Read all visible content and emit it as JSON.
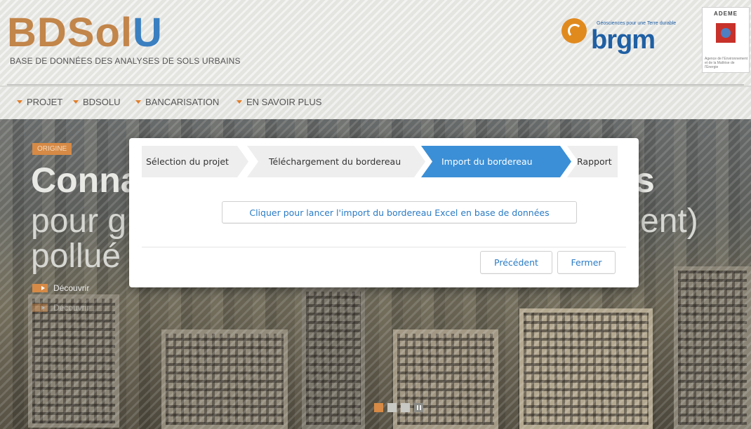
{
  "header": {
    "logo_part1": "BDSol",
    "logo_part2": "U",
    "subtitle": "BASE DE DONNÉES DES ANALYSES DE SOLS URBAINS",
    "brgm_name": "brgm",
    "brgm_tagline": "Géosciences pour une Terre durable",
    "ademe_name": "ADEME",
    "ademe_tagline": "Agence de l'Environnement et de la Maîtrise de l'Énergie"
  },
  "nav": {
    "items": [
      {
        "label": "PROJET"
      },
      {
        "label": "BDSOLU"
      },
      {
        "label": "BANCARISATION"
      },
      {
        "label": "EN SAVOIR PLUS"
      }
    ]
  },
  "hero": {
    "badge": "ORIGINE",
    "line1": "Conna",
    "line1_right": "s",
    "line2": "pour g",
    "line2_right": "ent)",
    "line3": "pollué",
    "link1": "Découvrir",
    "link2": "Découvrir"
  },
  "modal": {
    "steps": [
      {
        "label": "Sélection du projet",
        "active": false
      },
      {
        "label": "Téléchargement du bordereau",
        "active": false
      },
      {
        "label": "Import du bordereau",
        "active": true
      },
      {
        "label": "Rapport",
        "active": false
      }
    ],
    "import_button": "Cliquer pour lancer l'import du bordereau Excel en base de données",
    "previous_button": "Précédent",
    "close_button": "Fermer"
  },
  "colors": {
    "accent_orange": "#d68a45",
    "active_step": "#3b8fd6",
    "link_blue": "#2a7bc4"
  }
}
